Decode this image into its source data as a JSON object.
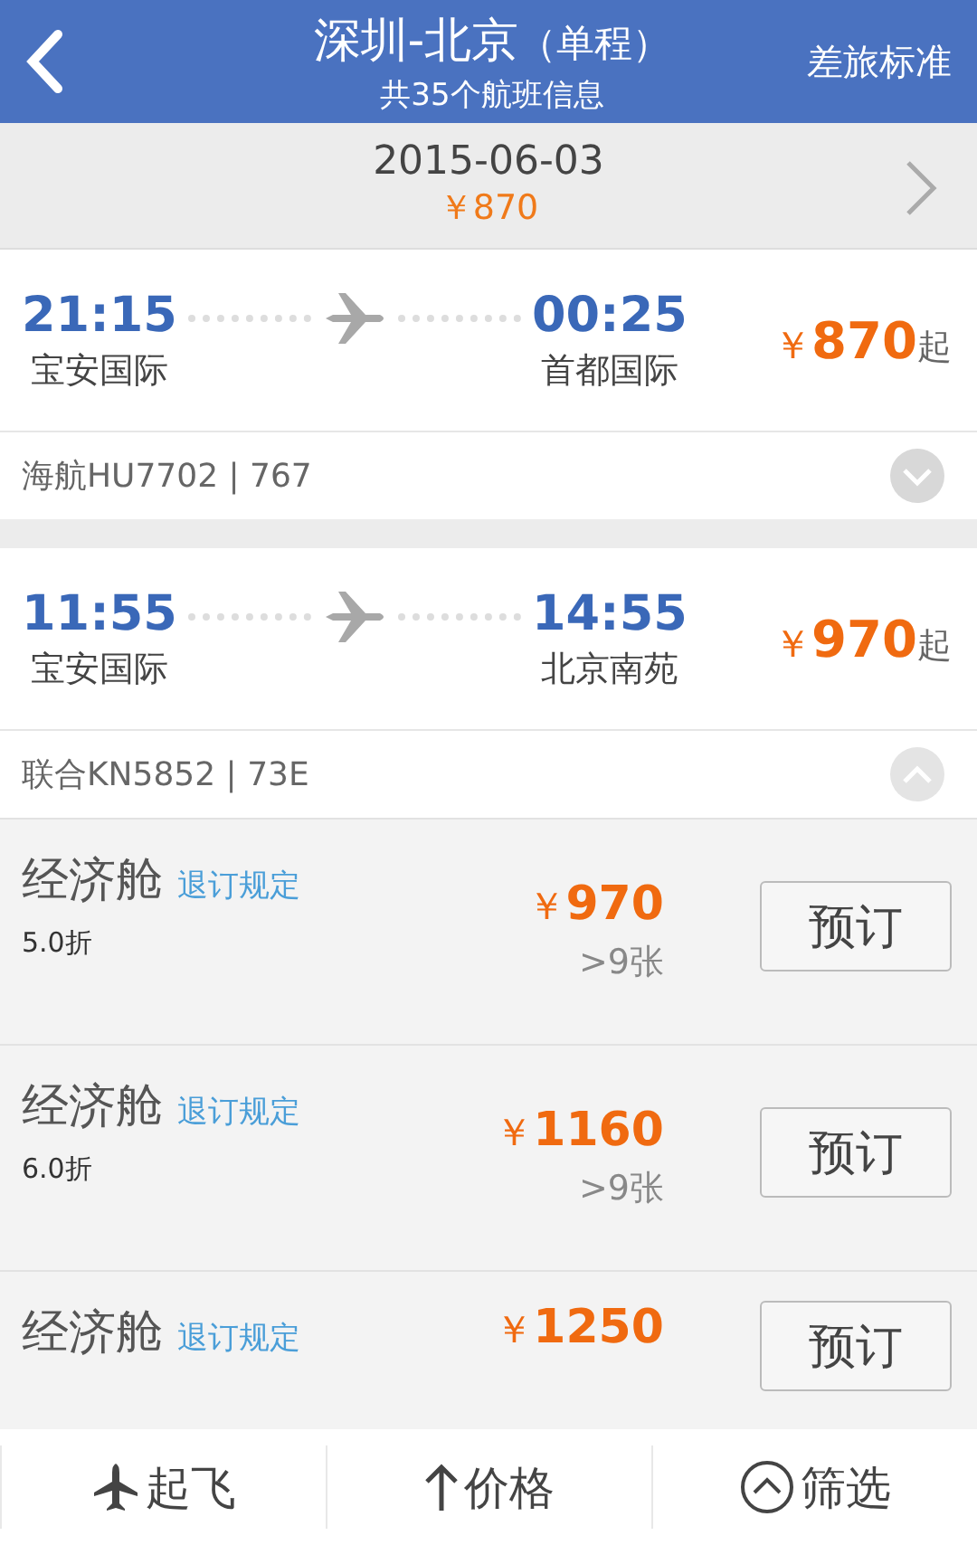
{
  "header": {
    "title": "深圳-北京",
    "trip_type": "（单程）",
    "subtitle": "共35个航班信息",
    "action": "差旅标准"
  },
  "date_bar": {
    "date": "2015-06-03",
    "lowest_price": "￥870"
  },
  "flights": [
    {
      "depart_time": "21:15",
      "depart_airport": "宝安国际",
      "arrive_time": "00:25",
      "arrive_airport": "首都国际",
      "currency": "￥",
      "price": "870",
      "price_suffix": "起",
      "flight_info": "海航HU7702 | 767",
      "expanded": false
    },
    {
      "depart_time": "11:55",
      "depart_airport": "宝安国际",
      "arrive_time": "14:55",
      "arrive_airport": "北京南苑",
      "currency": "￥",
      "price": "970",
      "price_suffix": "起",
      "flight_info": "联合KN5852 | 73E",
      "expanded": true,
      "fares": [
        {
          "cabin": "经济舱",
          "rules_link": "退订规定",
          "discount": "5.0折",
          "currency": "￥",
          "price": "970",
          "seats": ">9张",
          "book": "预订"
        },
        {
          "cabin": "经济舱",
          "rules_link": "退订规定",
          "discount": "6.0折",
          "currency": "￥",
          "price": "1160",
          "seats": ">9张",
          "book": "预订"
        },
        {
          "cabin": "经济舱",
          "rules_link": "退订规定",
          "currency": "￥",
          "price": "1250",
          "book": "预订"
        }
      ]
    }
  ],
  "bottom_bar": [
    {
      "kind": "plane",
      "label": "起飞"
    },
    {
      "kind": "arrow",
      "label": "价格"
    },
    {
      "kind": "filter",
      "label": "筛选"
    }
  ]
}
